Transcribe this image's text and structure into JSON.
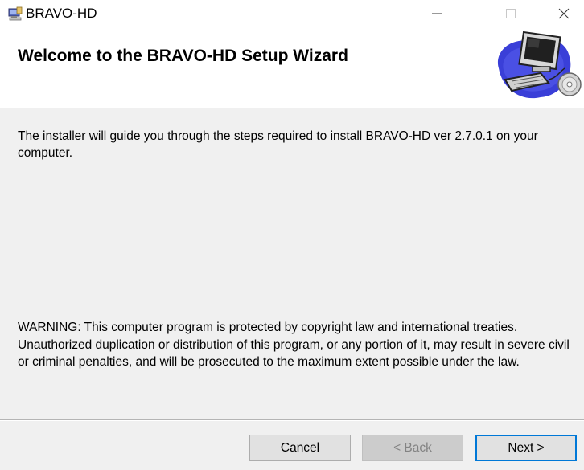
{
  "window": {
    "title": "BRAVO-HD"
  },
  "banner": {
    "title": "Welcome to the BRAVO-HD Setup Wizard"
  },
  "content": {
    "intro": "The installer will guide you through the steps required to install BRAVO-HD ver 2.7.0.1 on your computer.",
    "warning": "WARNING: This computer program is protected by copyright law and international treaties. Unauthorized duplication or distribution of this program, or any portion of it, may result in severe civil or criminal penalties, and will be prosecuted to the maximum extent possible under the law."
  },
  "buttons": {
    "cancel": "Cancel",
    "back": "< Back",
    "next": "Next >"
  },
  "icons": {
    "app": "installer-app-icon",
    "banner": "computer-setup-icon",
    "minimize": "minimize-icon",
    "maximize": "maximize-icon",
    "close": "close-icon"
  },
  "colors": {
    "accent": "#0078d7",
    "body_bg": "#f0f0f0",
    "banner_bg": "#ffffff"
  },
  "state": {
    "back_enabled": false
  }
}
